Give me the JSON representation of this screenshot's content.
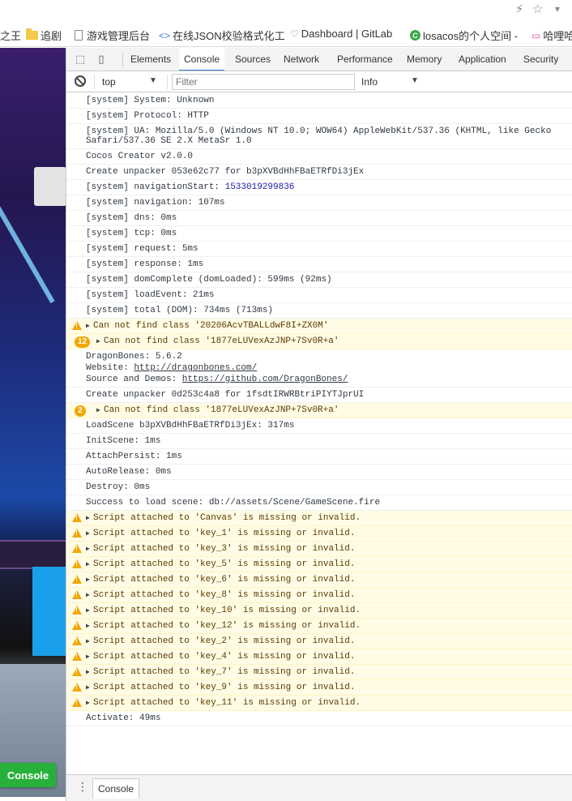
{
  "top_icons": {
    "bolt": "⚡",
    "star": "☆",
    "caret": "▾"
  },
  "bookmarks": [
    {
      "label": "之王",
      "icon": "none"
    },
    {
      "label": "追剧",
      "icon": "folder"
    },
    {
      "label": "游戏管理后台",
      "icon": "page"
    },
    {
      "label": "在线JSON校验格式化工",
      "icon": "code"
    },
    {
      "label": "Dashboard | GitLab",
      "icon": "fox"
    },
    {
      "label": "losacos的个人空间 -",
      "icon": "c-badge"
    },
    {
      "label": "哈哩哈",
      "icon": "tv"
    }
  ],
  "game": {
    "console_button": "Console"
  },
  "devtools": {
    "tabs": [
      "Elements",
      "Console",
      "Sources",
      "Network",
      "Performance",
      "Memory",
      "Application",
      "Security"
    ],
    "active_tab": "Console",
    "context": "top",
    "filter_placeholder": "Filter",
    "level": "Info",
    "drawer_tab": "Console"
  },
  "log": [
    {
      "type": "log",
      "text": "[system] System: Unknown"
    },
    {
      "type": "log",
      "text": "[system] Protocol: HTTP"
    },
    {
      "type": "log2",
      "text": "[system] UA: Mozilla/5.0 (Windows NT 10.0; WOW64) AppleWebKit/537.36 (KHTML, like Gecko",
      "text2": "Safari/537.36 SE 2.X MetaSr 1.0"
    },
    {
      "type": "log",
      "text": "Cocos Creator v2.0.0"
    },
    {
      "type": "log",
      "text": "Create unpacker 053e62c77 for b3pXVBdHhFBaETRfDi3jEx"
    },
    {
      "type": "lognum",
      "text": "[system] navigationStart: ",
      "num": "1533019299836"
    },
    {
      "type": "log",
      "text": "[system] navigation: 107ms"
    },
    {
      "type": "log",
      "text": "[system] dns: 0ms"
    },
    {
      "type": "log",
      "text": "[system] tcp: 0ms"
    },
    {
      "type": "log",
      "text": "[system] request: 5ms"
    },
    {
      "type": "log",
      "text": "[system] response: 1ms"
    },
    {
      "type": "log",
      "text": "[system] domComplete (domLoaded): 599ms (92ms)"
    },
    {
      "type": "log",
      "text": "[system] loadEvent: 21ms"
    },
    {
      "type": "log",
      "text": "[system] total (DOM): 734ms (713ms)"
    },
    {
      "type": "warn",
      "text": "Can not find class '20206AcvTBALLdwF8I+ZX0M'"
    },
    {
      "type": "count",
      "count": "12",
      "text": "Can not find class '1877eLUVexAzJNP+7Sv0R+a'"
    },
    {
      "type": "dragon",
      "line1": "DragonBones: 5.6.2",
      "line2_label": "Website: ",
      "line2_link": "http://dragonbones.com/",
      "line3_label": "Source and Demos: ",
      "line3_link": "https://github.com/DragonBones/"
    },
    {
      "type": "log",
      "text": "Create unpacker 0d253c4a8 for 1fsdtIRWRBtriPIYTJprUI"
    },
    {
      "type": "count",
      "count": "2",
      "text": "Can not find class '1877eLUVexAzJNP+7Sv0R+a'"
    },
    {
      "type": "log",
      "text": "LoadScene b3pXVBdHhFBaETRfDi3jEx: 317ms"
    },
    {
      "type": "log",
      "text": "InitScene: 1ms"
    },
    {
      "type": "log",
      "text": "AttachPersist: 1ms"
    },
    {
      "type": "log",
      "text": "AutoRelease: 0ms"
    },
    {
      "type": "log",
      "text": "Destroy: 0ms"
    },
    {
      "type": "log",
      "text": "Success to load scene: db://assets/Scene/GameScene.fire"
    },
    {
      "type": "warn",
      "text": "Script attached to 'Canvas' is missing or invalid."
    },
    {
      "type": "warn",
      "text": "Script attached to 'key_1' is missing or invalid."
    },
    {
      "type": "warn",
      "text": "Script attached to 'key_3' is missing or invalid."
    },
    {
      "type": "warn",
      "text": "Script attached to 'key_5' is missing or invalid."
    },
    {
      "type": "warn",
      "text": "Script attached to 'key_6' is missing or invalid."
    },
    {
      "type": "warn",
      "text": "Script attached to 'key_8' is missing or invalid."
    },
    {
      "type": "warn",
      "text": "Script attached to 'key_10' is missing or invalid."
    },
    {
      "type": "warn",
      "text": "Script attached to 'key_12' is missing or invalid."
    },
    {
      "type": "warn",
      "text": "Script attached to 'key_2' is missing or invalid."
    },
    {
      "type": "warn",
      "text": "Script attached to 'key_4' is missing or invalid."
    },
    {
      "type": "warn",
      "text": "Script attached to 'key_7' is missing or invalid."
    },
    {
      "type": "warn",
      "text": "Script attached to 'key_9' is missing or invalid."
    },
    {
      "type": "warn",
      "text": "Script attached to 'key_11' is missing or invalid."
    },
    {
      "type": "log",
      "text": "Activate: 49ms"
    }
  ],
  "prompt_glyph": "›",
  "colors": {
    "warn_bg": "#fffbe5",
    "warn_icon": "#f2a600",
    "accent": "#3879d9",
    "console_button": "#27b13b"
  }
}
